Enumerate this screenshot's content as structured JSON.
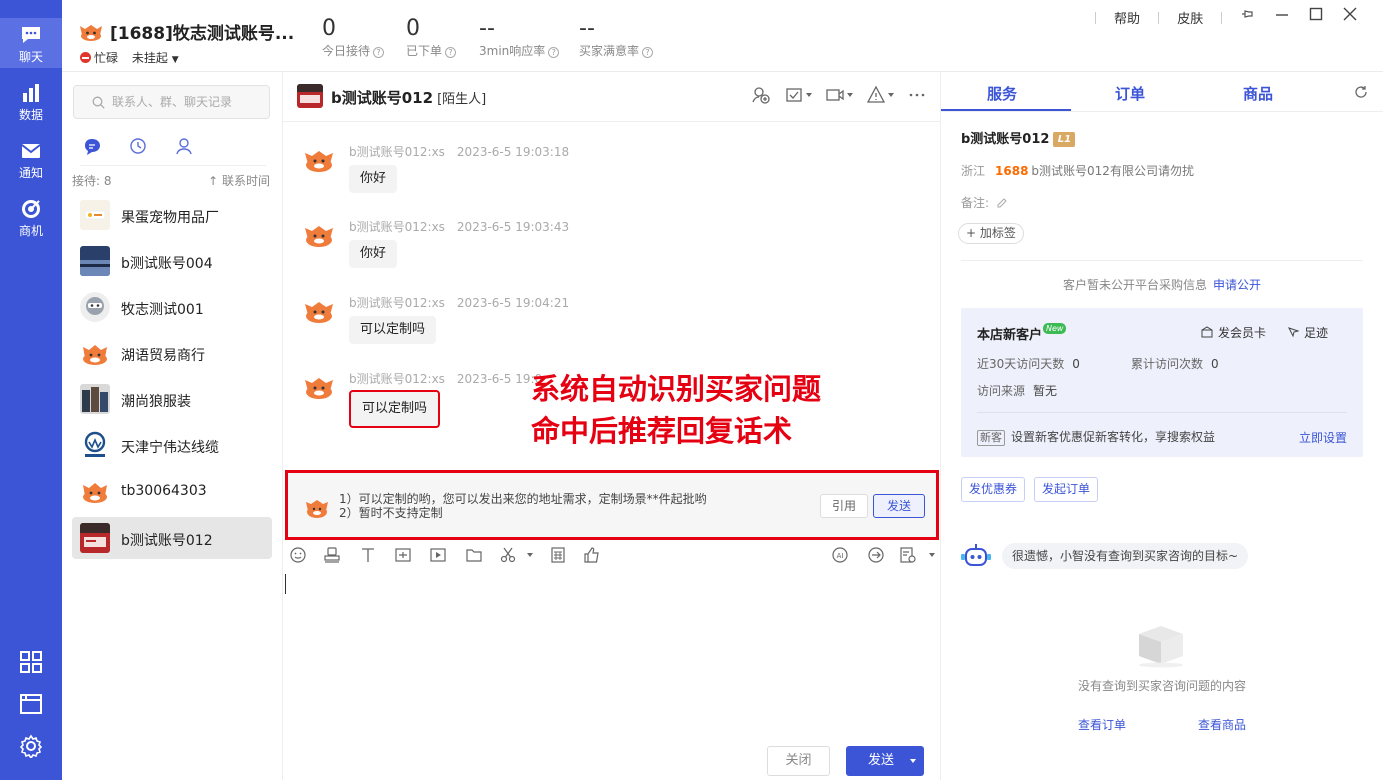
{
  "rail": {
    "items": [
      {
        "label": "聊天"
      },
      {
        "label": "数据"
      },
      {
        "label": "通知"
      },
      {
        "label": "商机"
      }
    ]
  },
  "header": {
    "account_name": "[1688]牧志测试账号...",
    "status": "忙碌",
    "hang": "未挂起",
    "stats": [
      {
        "value": "0",
        "label": "今日接待"
      },
      {
        "value": "0",
        "label": "已下单"
      },
      {
        "value": "--",
        "label": "3min响应率"
      },
      {
        "value": "--",
        "label": "买家满意率"
      }
    ],
    "help": "帮助",
    "skin": "皮肤"
  },
  "contacts": {
    "search_placeholder": "联系人、群、聊天记录",
    "receive_count": "接待: 8",
    "sort_label": "↑ 联系时间",
    "items": [
      {
        "name": "果蛋宠物用品厂"
      },
      {
        "name": "b测试账号004"
      },
      {
        "name": "牧志测试001"
      },
      {
        "name": "湖语贸易商行"
      },
      {
        "name": "潮尚狼服装"
      },
      {
        "name": "天津宁伟达线缆"
      },
      {
        "name": "tb30064303"
      },
      {
        "name": "b测试账号012"
      }
    ]
  },
  "chat": {
    "title": "b测试账号012",
    "tag": "[陌生人]",
    "messages": [
      {
        "sender": "b测试账号012:xs",
        "time": "2023-6-5 19:03:18",
        "text": "你好"
      },
      {
        "sender": "b测试账号012:xs",
        "time": "2023-6-5 19:03:43",
        "text": "你好"
      },
      {
        "sender": "b测试账号012:xs",
        "time": "2023-6-5 19:04:21",
        "text": "可以定制吗"
      },
      {
        "sender": "b测试账号012:xs",
        "time": "2023-6-5 19:0",
        "text": "可以定制吗"
      }
    ],
    "annotation": {
      "line1": "系统自动识别买家问题",
      "line2": "命中后推荐回复话术"
    },
    "suggest": {
      "line1": "1）可以定制的哟，您可以发出来您的地址需求，定制场景**件起批哟",
      "line2": "2）暂时不支持定制",
      "quote": "引用",
      "send": "发送"
    },
    "close_button": "关闭",
    "send_button": "发送"
  },
  "right": {
    "tabs": [
      "服务",
      "订单",
      "商品"
    ],
    "customer": {
      "name": "b测试账号012",
      "level": "L1",
      "province": "浙江",
      "brand": "1688",
      "company": "b测试账号012有限公司请勿扰",
      "remark": "备注:",
      "add_tag": "+ 加标签"
    },
    "public_info": "客户暂未公开平台采购信息",
    "public_link": "申请公开",
    "new_customer": {
      "title": "本店新客户",
      "new_badge": "New",
      "member_card": "发会员卡",
      "footprint": "足迹",
      "visit_days_label": "近30天访问天数",
      "visit_days": "0",
      "total_visits_label": "累计访问次数",
      "total_visits": "0",
      "source_label": "访问来源",
      "source": "暂无",
      "tip_badge": "新客",
      "tip": "设置新客优惠促新客转化，享搜索权益",
      "setup": "立即设置"
    },
    "coupon_button": "发优惠券",
    "order_button": "发起订单",
    "bot_message": "很遗憾，小智没有查询到买家咨询的目标~",
    "empty_text": "没有查询到买家咨询问题的内容",
    "view_orders": "查看订单",
    "view_products": "查看商品"
  }
}
